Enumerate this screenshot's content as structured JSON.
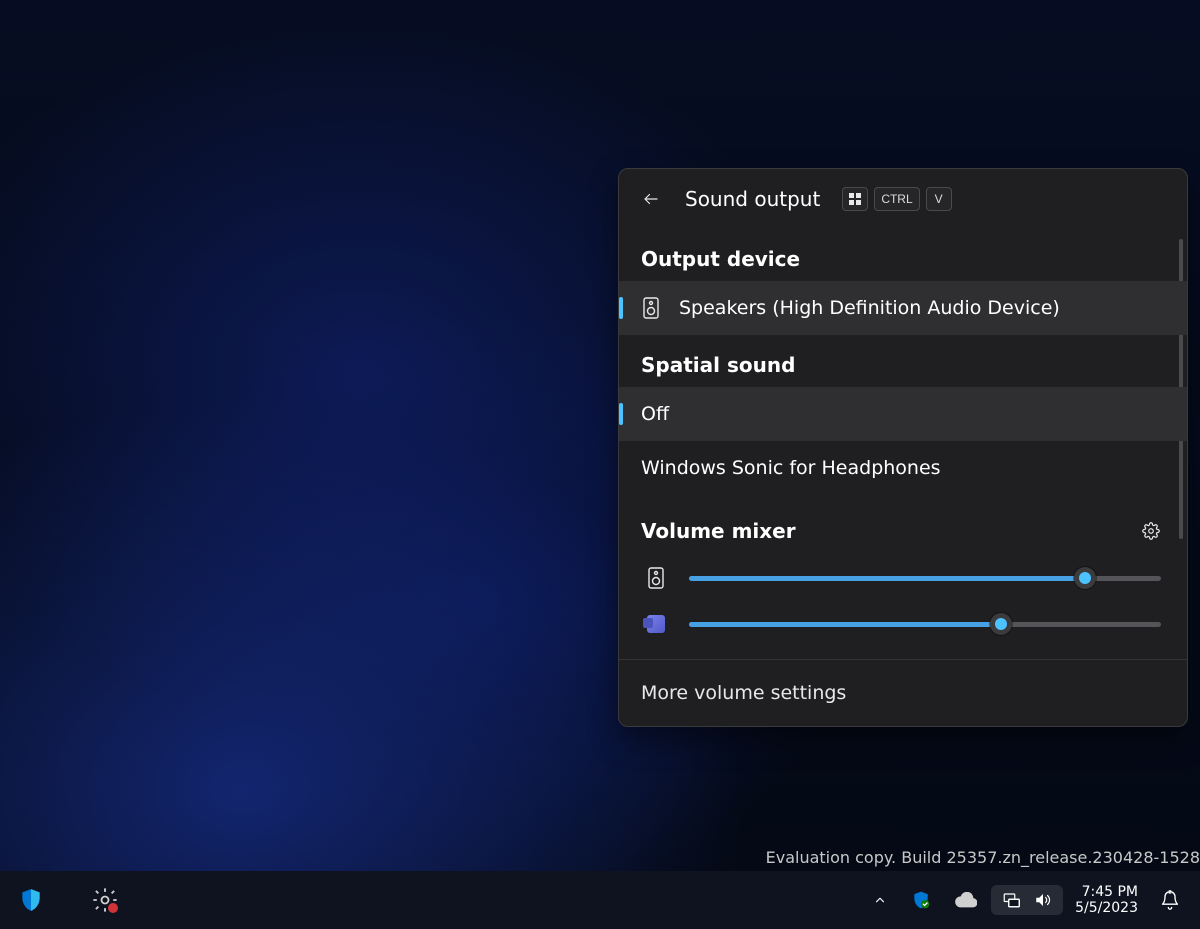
{
  "flyout": {
    "title": "Sound output",
    "shortcut_keys": [
      "Win",
      "CTRL",
      "V"
    ],
    "output_device_heading": "Output device",
    "output_device": {
      "name": "Speakers (High Definition Audio Device)",
      "selected": true
    },
    "spatial_sound_heading": "Spatial sound",
    "spatial_sound_options": [
      {
        "label": "Off",
        "selected": true
      },
      {
        "label": "Windows Sonic for Headphones",
        "selected": false
      }
    ],
    "volume_mixer_heading": "Volume mixer",
    "mixer": [
      {
        "app": "System Speakers",
        "value": 84
      },
      {
        "app": "Microsoft Teams",
        "value": 66
      }
    ],
    "more_link": "More volume settings"
  },
  "watermark": "Evaluation copy. Build 25357.zn_release.230428-1528",
  "taskbar": {
    "time": "7:45 PM",
    "date": "5/5/2023"
  }
}
